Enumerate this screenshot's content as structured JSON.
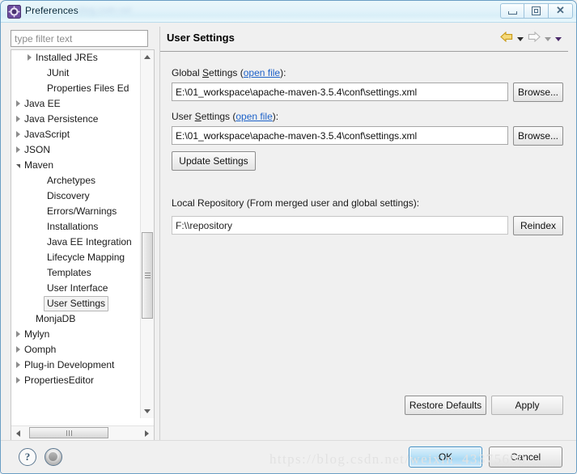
{
  "window": {
    "title": "Preferences",
    "title_icon": "gear-icon",
    "title_watermark": "blog.csdn.net",
    "minimize_label": "",
    "maximize_label": "",
    "close_label": "✕"
  },
  "filter": {
    "placeholder": "type filter text",
    "value": ""
  },
  "tree": {
    "items": [
      {
        "label": "Installed JREs",
        "indent": 30,
        "twisty": "closed",
        "selected": false
      },
      {
        "label": "JUnit",
        "indent": 44,
        "twisty": "none",
        "selected": false
      },
      {
        "label": "Properties Files Ed",
        "indent": 44,
        "twisty": "none",
        "selected": false
      },
      {
        "label": "Java EE",
        "indent": 16,
        "twisty": "closed",
        "selected": false
      },
      {
        "label": "Java Persistence",
        "indent": 16,
        "twisty": "closed",
        "selected": false
      },
      {
        "label": "JavaScript",
        "indent": 16,
        "twisty": "closed",
        "selected": false
      },
      {
        "label": "JSON",
        "indent": 16,
        "twisty": "closed",
        "selected": false
      },
      {
        "label": "Maven",
        "indent": 16,
        "twisty": "open",
        "selected": false
      },
      {
        "label": "Archetypes",
        "indent": 44,
        "twisty": "none",
        "selected": false
      },
      {
        "label": "Discovery",
        "indent": 44,
        "twisty": "none",
        "selected": false
      },
      {
        "label": "Errors/Warnings",
        "indent": 44,
        "twisty": "none",
        "selected": false
      },
      {
        "label": "Installations",
        "indent": 44,
        "twisty": "none",
        "selected": false
      },
      {
        "label": "Java EE Integration",
        "indent": 44,
        "twisty": "none",
        "selected": false
      },
      {
        "label": "Lifecycle Mapping",
        "indent": 44,
        "twisty": "none",
        "selected": false
      },
      {
        "label": "Templates",
        "indent": 44,
        "twisty": "none",
        "selected": false
      },
      {
        "label": "User Interface",
        "indent": 44,
        "twisty": "none",
        "selected": false
      },
      {
        "label": "User Settings",
        "indent": 44,
        "twisty": "none",
        "selected": true
      },
      {
        "label": "MonjaDB",
        "indent": 30,
        "twisty": "none",
        "selected": false
      },
      {
        "label": "Mylyn",
        "indent": 16,
        "twisty": "closed",
        "selected": false
      },
      {
        "label": "Oomph",
        "indent": 16,
        "twisty": "closed",
        "selected": false
      },
      {
        "label": "Plug-in Development",
        "indent": 16,
        "twisty": "closed",
        "selected": false
      },
      {
        "label": "PropertiesEditor",
        "indent": 16,
        "twisty": "closed",
        "selected": false
      }
    ]
  },
  "content": {
    "title": "User Settings",
    "nav": {
      "back_icon": "back-arrow-icon",
      "back_menu_icon": "chevron-down-icon",
      "forward_icon": "forward-arrow-icon",
      "forward_menu_icon": "chevron-down-icon",
      "view_menu_icon": "chevron-down-icon"
    },
    "global_settings": {
      "label_pre": "Global ",
      "label_mnemonic": "S",
      "label_post": "ettings (",
      "link": "open file",
      "label_end": "):",
      "value": "E:\\01_workspace\\apache-maven-3.5.4\\conf\\settings.xml",
      "browse_label": "Browse..."
    },
    "user_settings": {
      "label_pre": "User ",
      "label_mnemonic": "S",
      "label_post": "ettings (",
      "link": "open file",
      "label_end": "):",
      "value": "E:\\01_workspace\\apache-maven-3.5.4\\conf\\settings.xml",
      "browse_label": "Browse...",
      "update_label": "Update Settings"
    },
    "local_repository": {
      "label": "Local Repository (From merged user and global settings):",
      "value": "F:\\\\repository",
      "reindex_label": "Reindex"
    },
    "restore_defaults_label": "Restore Defaults",
    "apply_label": "Apply"
  },
  "footer": {
    "help_icon": "help-circle-icon",
    "help_glyph": "?",
    "secondary_icon": "record-circle-icon",
    "ok_label": "OK",
    "cancel_label": "Cancel"
  },
  "watermark": {
    "bottom_text": "https://blog.csdn.net/weixin_43375650"
  },
  "colors": {
    "title_bar": "#e2f3fa",
    "panel_bg": "#f0f0f0",
    "link": "#1d62c9",
    "ok_accent": "#a9d9f4",
    "back_arrow": "#e8b923",
    "forward_arrow": "#b0b0b0"
  }
}
